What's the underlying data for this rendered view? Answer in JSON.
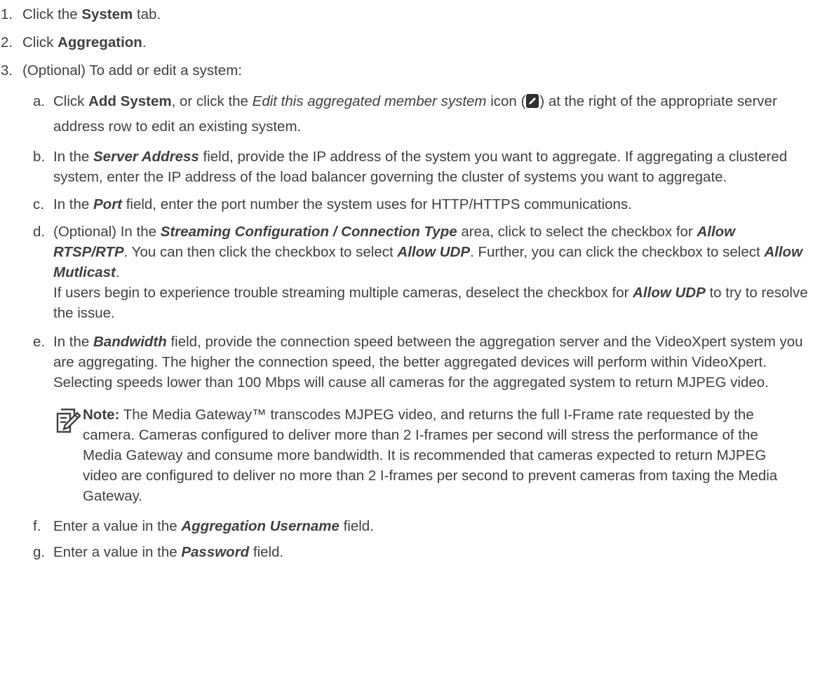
{
  "steps": [
    {
      "num": "1.",
      "pre": "Click the ",
      "bold": "System",
      "post": " tab."
    },
    {
      "num": "2.",
      "pre": "Click ",
      "bold": "Aggregation",
      "post": "."
    },
    {
      "num": "3.",
      "text": "(Optional) To add or edit a system:"
    }
  ],
  "sub_a": {
    "letter": "a.",
    "t1": "Click ",
    "b1": "Add System",
    "t2": ", or click the ",
    "i1": "Edit this aggregated member system",
    "t3": " icon (",
    "t4": ") at the right of the appropriate server address row to edit an existing system.",
    "icon": "pencil-edit-icon"
  },
  "sub_b": {
    "letter": "b.",
    "t1": "In the ",
    "i1": "Server Address",
    "t2": " field, provide the IP address of the system you want to aggregate. If aggregating a clustered system, enter the IP address of the load balancer governing the cluster of systems you want to aggregate."
  },
  "sub_c": {
    "letter": "c.",
    "t1": "In the ",
    "i1": "Port",
    "t2": " field, enter the port number the system uses for HTTP/HTTPS communications."
  },
  "sub_d": {
    "letter": "d.",
    "t1": "(Optional) In the ",
    "i1": "Streaming Configuration / Connection Type",
    "t2": " area, click to select the checkbox for ",
    "i2": "Allow RTSP/RTP",
    "t3": ". You can then click the checkbox to select ",
    "i3": "Allow UDP",
    "t4": ". Further, you can click the checkbox to select ",
    "i4": "Allow Mutlicast",
    "t5": ".",
    "t6": "If users begin to experience trouble streaming multiple cameras, deselect the checkbox for ",
    "i5": "Allow UDP",
    "t7": " to try to resolve the issue."
  },
  "sub_e": {
    "letter": "e.",
    "t1": "In the ",
    "i1": "Bandwidth",
    "t2": " field, provide the connection speed between the aggregation server and the VideoXpert system you are aggregating. The higher the connection speed, the better aggregated devices will perform within VideoXpert. Selecting speeds lower than 100 Mbps will cause all cameras for the aggregated system to return MJPEG video."
  },
  "note": {
    "icon": "note-icon",
    "label": "Note:",
    "text": " The Media Gateway™ transcodes MJPEG video, and returns the full I-Frame rate requested by the camera. Cameras configured to deliver more than 2 I-frames per second will stress the performance of the Media Gateway and consume more bandwidth. It is recommended that cameras expected to return MJPEG video are configured to deliver no more than 2 I-frames per second to prevent cameras from taxing the Media Gateway."
  },
  "sub_f": {
    "letter": "f.",
    "t1": "Enter a value in the ",
    "i1": "Aggregation Username",
    "t2": " field."
  },
  "sub_g": {
    "letter": "g.",
    "t1": "Enter a value in the ",
    "i1": "Password",
    "t2": " field."
  }
}
